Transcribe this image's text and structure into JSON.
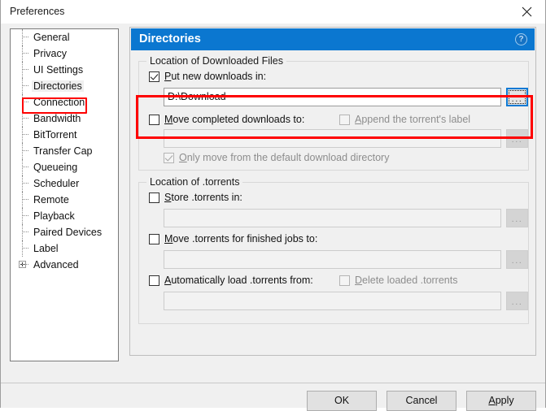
{
  "window": {
    "title": "Preferences",
    "close_icon": "close-icon"
  },
  "sidebar": {
    "items": [
      {
        "label": "General",
        "selected": false,
        "expandable": false
      },
      {
        "label": "Privacy",
        "selected": false,
        "expandable": false
      },
      {
        "label": "UI Settings",
        "selected": false,
        "expandable": false
      },
      {
        "label": "Directories",
        "selected": true,
        "expandable": false
      },
      {
        "label": "Connection",
        "selected": false,
        "expandable": false
      },
      {
        "label": "Bandwidth",
        "selected": false,
        "expandable": false
      },
      {
        "label": "BitTorrent",
        "selected": false,
        "expandable": false
      },
      {
        "label": "Transfer Cap",
        "selected": false,
        "expandable": false
      },
      {
        "label": "Queueing",
        "selected": false,
        "expandable": false
      },
      {
        "label": "Scheduler",
        "selected": false,
        "expandable": false
      },
      {
        "label": "Remote",
        "selected": false,
        "expandable": false
      },
      {
        "label": "Playback",
        "selected": false,
        "expandable": false
      },
      {
        "label": "Paired Devices",
        "selected": false,
        "expandable": false
      },
      {
        "label": "Label",
        "selected": false,
        "expandable": false
      },
      {
        "label": "Advanced",
        "selected": false,
        "expandable": true
      }
    ]
  },
  "panel": {
    "title": "Directories",
    "help_icon": "?",
    "groups": {
      "downloads": {
        "title": "Location of Downloaded Files",
        "put_new_downloads": {
          "label": "Put new downloads in:",
          "accel": "P",
          "checked": true,
          "path_value": "D:\\Download",
          "browse_label": "...",
          "browse_focused": true
        },
        "move_completed": {
          "label": "Move completed downloads to:",
          "accel": "M",
          "checked": false,
          "path_value": "",
          "browse_label": "..."
        },
        "append_label": {
          "label": "Append the torrent's label",
          "accel": "A",
          "checked": false,
          "disabled": true
        },
        "only_move_default": {
          "label": "Only move from the default download directory",
          "accel": "O",
          "checked": true,
          "disabled": true
        }
      },
      "torrents": {
        "title": "Location of .torrents",
        "store_torrents": {
          "label": "Store .torrents in:",
          "accel": "S",
          "checked": false,
          "path_value": "",
          "browse_label": "..."
        },
        "move_finished": {
          "label": "Move .torrents for finished jobs to:",
          "accel": "M",
          "checked": false,
          "path_value": "",
          "browse_label": "..."
        },
        "auto_load": {
          "label": "Automatically load .torrents from:",
          "accel": "A",
          "checked": false,
          "path_value": "",
          "browse_label": "..."
        },
        "delete_loaded": {
          "label": "Delete loaded .torrents",
          "accel": "D",
          "checked": false,
          "disabled": true
        }
      }
    }
  },
  "footer": {
    "ok": "OK",
    "cancel": "Cancel",
    "apply": "Apply",
    "apply_accel": "A"
  },
  "annotations": {
    "highlight_color": "#fe0000",
    "accent_color": "#0b77d0"
  }
}
